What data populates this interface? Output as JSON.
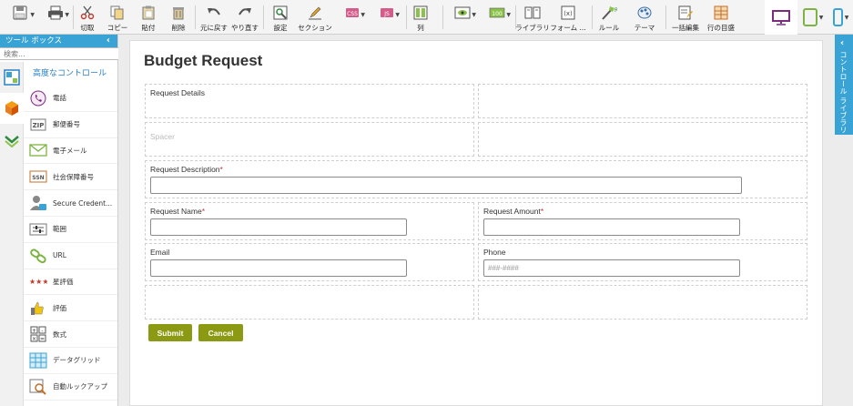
{
  "toolbar": {
    "cut": "切取",
    "copy": "コピー",
    "paste": "貼付",
    "delete": "削除",
    "undo": "元に戻す",
    "redo": "やり直す",
    "settings": "設定",
    "section": "セクション",
    "column": "列",
    "library": "ライブラリ",
    "form": "フォーム ...",
    "rule": "ルール",
    "theme": "テーマ",
    "bulk_edit": "一括編集",
    "row_guide": "行の目盛"
  },
  "left_panel": {
    "title": "ツール ボックス",
    "search_placeholder": "検索...",
    "category": "高度なコントロール",
    "items": [
      {
        "label": "電話"
      },
      {
        "label": "郵便番号"
      },
      {
        "label": "電子メール"
      },
      {
        "label": "社会保障番号"
      },
      {
        "label": "Secure Credent..."
      },
      {
        "label": "範囲"
      },
      {
        "label": "URL"
      },
      {
        "label": "星評価"
      },
      {
        "label": "評価"
      },
      {
        "label": "数式"
      },
      {
        "label": "データグリッド"
      },
      {
        "label": "自動ルックアップ"
      }
    ]
  },
  "right_panel": {
    "label": "コントロール ライブラリ"
  },
  "form": {
    "title": "Budget Request",
    "request_details": "Request Details",
    "spacer": "Spacer",
    "description_label": "Request Description",
    "name_label": "Request Name",
    "amount_label": "Request Amount",
    "email_label": "Email",
    "phone_label": "Phone",
    "phone_placeholder": "###-####",
    "required_mark": "*",
    "submit": "Submit",
    "cancel": "Cancel"
  },
  "colors": {
    "accent": "#3aa3d6",
    "button": "#8c9a13",
    "required": "#c0392b"
  }
}
